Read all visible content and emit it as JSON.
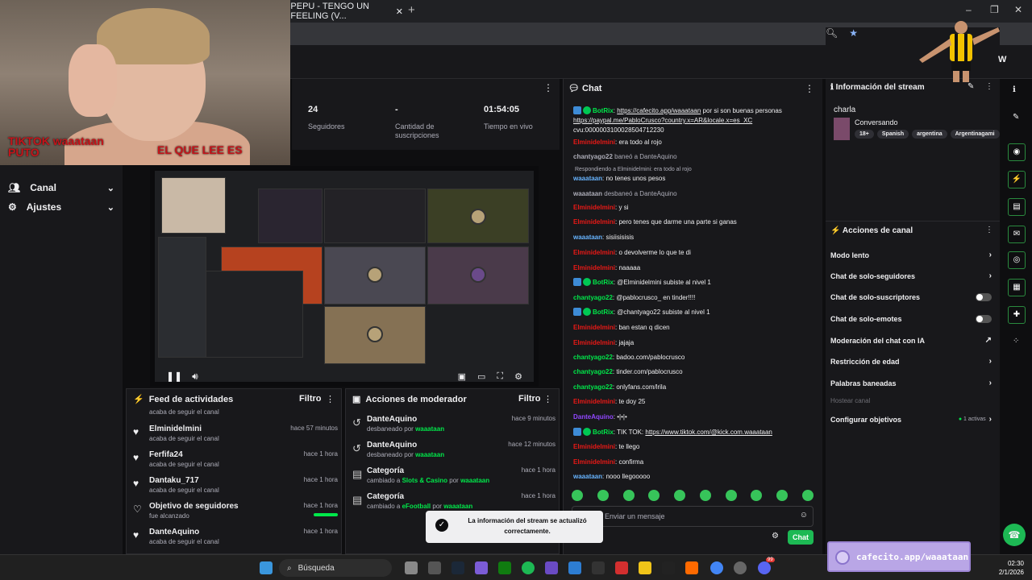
{
  "browser": {
    "tab_title": "PEPU - TENGO UN FEELING (V...",
    "new_tab": "+",
    "window_controls": [
      "–",
      "❐",
      "✕"
    ]
  },
  "overlay": {
    "line1": "TIKTOK waaataan",
    "line2": "PUTO",
    "line3": "EL QUE LEE ES"
  },
  "sidebar": {
    "items": [
      {
        "label": "Canal",
        "icon": "users-icon"
      },
      {
        "label": "Ajustes",
        "icon": "gear-icon"
      }
    ]
  },
  "stats": [
    {
      "value": "24",
      "label": "Seguidores"
    },
    {
      "value": "-",
      "label": "Cantidad de suscripciones"
    },
    {
      "value": "01:54:05",
      "label": "Tiempo en vivo"
    }
  ],
  "activity_feed": {
    "title": "Feed de actividades",
    "filter": "Filtro",
    "top_partial": "acaba de seguir el canal",
    "items": [
      {
        "name": "Elminidelmini",
        "sub": "acaba de seguir el canal",
        "time": "hace 57 minutos"
      },
      {
        "name": "Ferfifa24",
        "sub": "acaba de seguir el canal",
        "time": "hace 1 hora"
      },
      {
        "name": "Dantaku_717",
        "sub": "acaba de seguir el canal",
        "time": "hace 1 hora"
      },
      {
        "name": "Objetivo de seguidores",
        "sub": "fue alcanzado",
        "time": "hace 1 hora"
      },
      {
        "name": "DanteAquino",
        "sub": "acaba de seguir el canal",
        "time": "hace 1 hora"
      }
    ]
  },
  "mod_actions": {
    "title": "Acciones de moderador",
    "filter": "Filtro",
    "items": [
      {
        "name": "DanteAquino",
        "sub": "desbaneado por",
        "by": "waaataan",
        "time": "hace 9 minutos"
      },
      {
        "name": "DanteAquino",
        "sub": "desbaneado por",
        "by": "waaataan",
        "time": "hace 12 minutos"
      },
      {
        "name": "Categoría",
        "sub": "cambiado a",
        "target": "Slots & Casino",
        "by_word": "por",
        "by": "waaataan",
        "time": "hace 1 hora"
      },
      {
        "name": "Categoría",
        "sub": "cambiado a",
        "target": "eFootball",
        "by_word": "por",
        "by": "waaataan",
        "time": "hace 1 hora"
      }
    ]
  },
  "toast": {
    "text": "La información del stream se actualizó correctamente."
  },
  "chat": {
    "title": "Chat",
    "messages": [
      {
        "user": "BotRix",
        "color": "green",
        "badge": true,
        "text": "",
        "link": "https://cafecito.app/waaataan",
        "text2": "por si son buenas personas"
      },
      {
        "user": "",
        "text": "",
        "link": "https://paypal.me/PabloCrusco?country.x=AR&locale.x=es_XC"
      },
      {
        "user": "",
        "text": "cvu:0000003100028504712230"
      },
      {
        "user": "Elminidelmini",
        "color": "red",
        "text": "era todo al rojo"
      },
      {
        "user": "chantyago22",
        "color": "gray",
        "text": "baneó a DanteAquino",
        "system": true
      },
      {
        "user": "",
        "text": "Respondiendo a Elminidelmini: era todo al rojo",
        "reply": true
      },
      {
        "user": "waaataan",
        "color": "blue",
        "text": "no tenes unos pesos"
      },
      {
        "user": "waaataan",
        "color": "gray",
        "text": "desbaneó a DanteAquino",
        "system": true
      },
      {
        "user": "Elminidelmini",
        "color": "red",
        "text": "y si"
      },
      {
        "user": "Elminidelmini",
        "color": "red",
        "text": "pero tenes que darme una parte si ganas"
      },
      {
        "user": "waaataan",
        "color": "blue",
        "text": "sisiisisisis"
      },
      {
        "user": "Elminidelmini",
        "color": "red",
        "text": "o devolverme lo que te di"
      },
      {
        "user": "Elminidelmini",
        "color": "red",
        "text": "naaaaa"
      },
      {
        "user": "BotRix",
        "color": "green",
        "badge": true,
        "text": "@Elminidelmini subiste al nivel 1"
      },
      {
        "user": "chantyago22",
        "color": "green",
        "text": "@pablocrusco_ en tinder!!!!"
      },
      {
        "user": "BotRix",
        "color": "green",
        "badge": true,
        "text": "@chantyago22 subiste al nivel 1"
      },
      {
        "user": "Elminidelmini",
        "color": "red",
        "text": "ban estan q dicen"
      },
      {
        "user": "Elminidelmini",
        "color": "red",
        "text": "jajaja"
      },
      {
        "user": "chantyago22",
        "color": "green",
        "text": "badoo.com/pablocrusco"
      },
      {
        "user": "chantyago22",
        "color": "green",
        "text": "tinder.com/pablocrusco"
      },
      {
        "user": "chantyago22",
        "color": "green",
        "text": "onlyfans.com/lrila"
      },
      {
        "user": "Elminidelmini",
        "color": "red",
        "text": "te doy 25"
      },
      {
        "user": "DanteAquino",
        "color": "purple",
        "text": "•|•|•"
      },
      {
        "user": "BotRix",
        "color": "green",
        "badge": true,
        "text": "TIK TOK:",
        "link": "https://www.tiktok.com/@kick.com.waaataan"
      },
      {
        "user": "Elminidelmini",
        "color": "red",
        "text": "te llego"
      },
      {
        "user": "Elminidelmini",
        "color": "red",
        "text": "confirma"
      },
      {
        "user": "waaataan",
        "color": "blue",
        "text": "nooo llegooooo"
      }
    ],
    "input_placeholder": "Enviar un mensaje",
    "send_label": "Chat"
  },
  "stream_info": {
    "title": "Información del stream",
    "stream_title": "charla",
    "category": "Conversando",
    "tags": [
      "18+",
      "Spanish",
      "argentina",
      "Argentinagami"
    ]
  },
  "channel_actions": {
    "title": "Acciones de canal",
    "items": [
      {
        "label": "Modo lento",
        "control": "chevron"
      },
      {
        "label": "Chat de solo-seguidores",
        "control": "chevron"
      },
      {
        "label": "Chat de solo-suscriptores",
        "control": "toggle"
      },
      {
        "label": "Chat de solo-emotes",
        "control": "toggle"
      },
      {
        "label": "Moderación del chat con IA",
        "control": "external"
      },
      {
        "label": "Restricción de edad",
        "control": "chevron"
      },
      {
        "label": "Palabras baneadas",
        "control": "chevron"
      },
      {
        "label": "Hostear canal",
        "control": "none",
        "disabled": true
      },
      {
        "label": "Configurar objetivos",
        "control": "chevron",
        "badge": "1 activas"
      }
    ]
  },
  "cafecito": {
    "text": "cafecito.app/waaataan"
  },
  "taskbar": {
    "search": "Búsqueda",
    "time": "02:30",
    "date": "2/1/2026",
    "notification_count": "99"
  },
  "colors": {
    "accent": "#00e84a",
    "red_user": "#e91916",
    "blue_user": "#67b4ff",
    "purple_user": "#9147ff"
  }
}
